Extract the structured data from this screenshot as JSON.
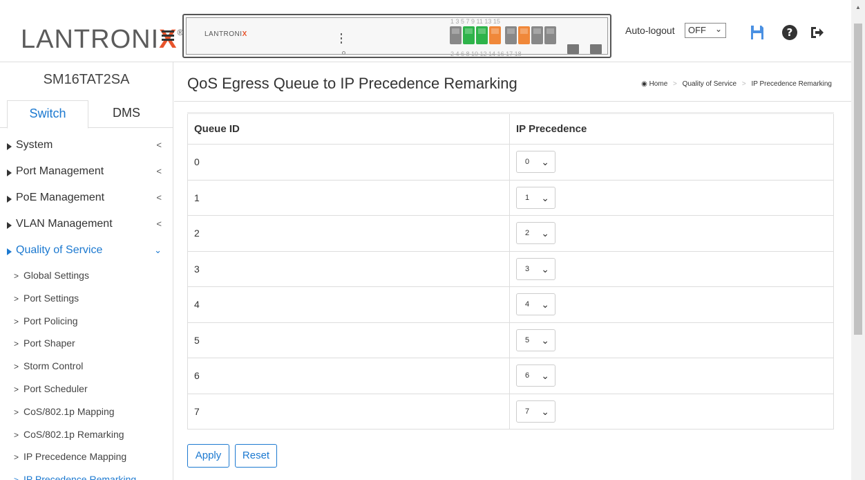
{
  "header": {
    "logo_text": "LANTRONIX",
    "logo_mark": "®",
    "device_brand": "LANTRONIX",
    "port_numbers_top": "1  3  5  7       9  11  13  15",
    "port_numbers_bottom": "2  4  6  8      10  12  14  16     17     18",
    "auto_logout_label": "Auto-logout",
    "auto_logout_value": "OFF",
    "icons": [
      "save-icon",
      "help-icon",
      "logout-icon"
    ],
    "accent_color": "#1c79d0"
  },
  "sidebar": {
    "device_name": "SM16TAT2SA",
    "tabs": [
      {
        "label": "Switch",
        "active": true
      },
      {
        "label": "DMS",
        "active": false
      }
    ],
    "menu": [
      {
        "label": "System",
        "arrow": "<"
      },
      {
        "label": "Port Management",
        "arrow": "<"
      },
      {
        "label": "PoE Management",
        "arrow": "<"
      },
      {
        "label": "VLAN Management",
        "arrow": "<"
      },
      {
        "label": "Quality of Service",
        "arrow": "⌄",
        "open": true
      }
    ],
    "submenu": [
      {
        "label": "Global Settings"
      },
      {
        "label": "Port Settings"
      },
      {
        "label": "Port Policing"
      },
      {
        "label": "Port Shaper"
      },
      {
        "label": "Storm Control"
      },
      {
        "label": "Port Scheduler"
      },
      {
        "label": "CoS/802.1p Mapping"
      },
      {
        "label": "CoS/802.1p Remarking"
      },
      {
        "label": "IP Precedence Mapping"
      },
      {
        "label": "IP Precedence Remarking",
        "active": true
      }
    ]
  },
  "main": {
    "title": "QoS Egress Queue to IP Precedence Remarking",
    "breadcrumb": [
      "Home",
      "Quality of Service",
      "IP Precedence Remarking"
    ],
    "table": {
      "headers": [
        "Queue ID",
        "IP Precedence"
      ],
      "rows": [
        {
          "queue": "0",
          "precedence": "0"
        },
        {
          "queue": "1",
          "precedence": "1"
        },
        {
          "queue": "2",
          "precedence": "2"
        },
        {
          "queue": "3",
          "precedence": "3"
        },
        {
          "queue": "4",
          "precedence": "4"
        },
        {
          "queue": "5",
          "precedence": "5"
        },
        {
          "queue": "6",
          "precedence": "6"
        },
        {
          "queue": "7",
          "precedence": "7"
        }
      ]
    },
    "buttons": {
      "apply": "Apply",
      "reset": "Reset"
    }
  }
}
